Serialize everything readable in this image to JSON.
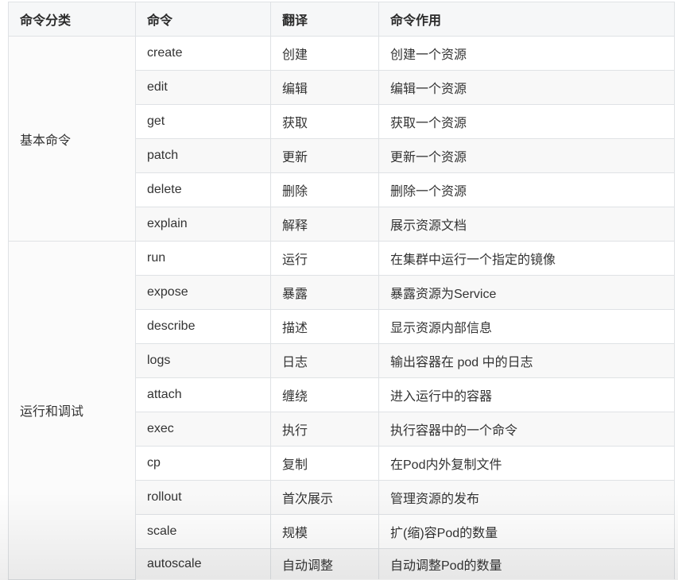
{
  "table": {
    "headers": {
      "category": "命令分类",
      "command": "命令",
      "translation": "翻译",
      "description": "命令作用"
    },
    "groups": [
      {
        "category": "基本命令",
        "rows": [
          {
            "command": "create",
            "translation": "创建",
            "description": "创建一个资源"
          },
          {
            "command": "edit",
            "translation": "编辑",
            "description": "编辑一个资源"
          },
          {
            "command": "get",
            "translation": "获取",
            "description": "获取一个资源"
          },
          {
            "command": "patch",
            "translation": "更新",
            "description": "更新一个资源"
          },
          {
            "command": "delete",
            "translation": "删除",
            "description": "删除一个资源"
          },
          {
            "command": "explain",
            "translation": "解释",
            "description": "展示资源文档"
          }
        ]
      },
      {
        "category": "运行和调试",
        "rows": [
          {
            "command": "run",
            "translation": "运行",
            "description": "在集群中运行一个指定的镜像"
          },
          {
            "command": "expose",
            "translation": "暴露",
            "description": "暴露资源为Service"
          },
          {
            "command": "describe",
            "translation": "描述",
            "description": "显示资源内部信息"
          },
          {
            "command": "logs",
            "translation": "日志",
            "description": "输出容器在 pod 中的日志"
          },
          {
            "command": "attach",
            "translation": "缠绕",
            "description": "进入运行中的容器"
          },
          {
            "command": "exec",
            "translation": "执行",
            "description": "执行容器中的一个命令"
          },
          {
            "command": "cp",
            "translation": "复制",
            "description": "在Pod内外复制文件"
          },
          {
            "command": "rollout",
            "translation": "首次展示",
            "description": "管理资源的发布"
          },
          {
            "command": "scale",
            "translation": "规模",
            "description": "扩(缩)容Pod的数量"
          },
          {
            "command": "autoscale",
            "translation": "自动调整",
            "description": "自动调整Pod的数量"
          }
        ]
      }
    ]
  }
}
